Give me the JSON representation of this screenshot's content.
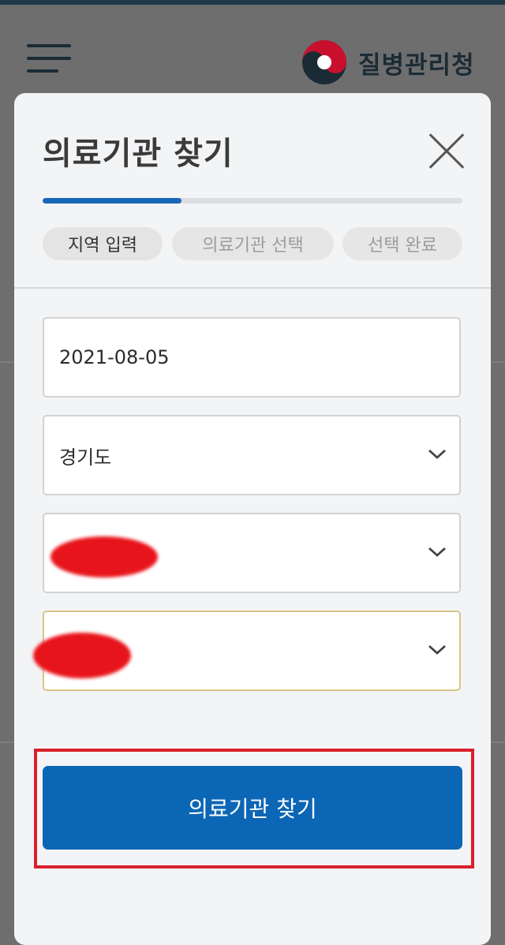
{
  "header": {
    "menu_icon": "hamburger-icon",
    "logo_icon": "taegeuk-icon",
    "brand_name": "질병관리청"
  },
  "modal": {
    "title": "의료기관 찾기",
    "close_icon": "close-icon",
    "progress_fraction": 0.33,
    "steps": [
      {
        "label": "지역 입력",
        "state": "active"
      },
      {
        "label": "의료기관 선택",
        "state": "inactive"
      },
      {
        "label": "선택 완료",
        "state": "inactive"
      }
    ],
    "fields": [
      {
        "value": "2021-08-05"
      },
      {
        "value": "경기도",
        "icon": "chevron-down-icon"
      },
      {
        "value": "",
        "icon": "chevron-down-icon",
        "redacted": true
      },
      {
        "value": "",
        "icon": "chevron-down-icon",
        "redacted": true
      }
    ],
    "search_button_label": "의료기관 찾기"
  },
  "colors": {
    "accent": "#0b66b5",
    "highlight_outline": "#d9202b",
    "redaction": "#e8141b"
  }
}
